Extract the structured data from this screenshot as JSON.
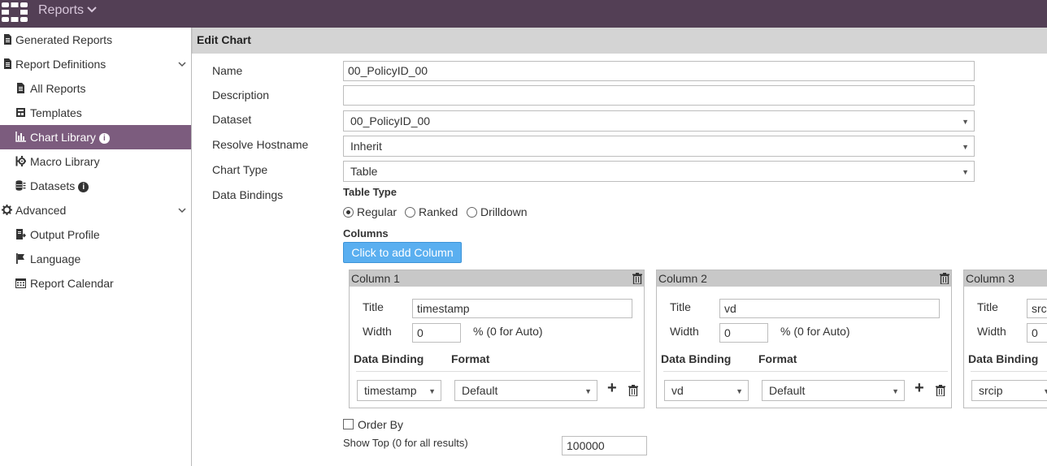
{
  "topbar": {
    "app_name": "Reports"
  },
  "sidebar": {
    "items": [
      {
        "label": "Generated Reports"
      },
      {
        "label": "Report Definitions"
      },
      {
        "label": "All Reports"
      },
      {
        "label": "Templates"
      },
      {
        "label": "Chart Library"
      },
      {
        "label": "Macro Library"
      },
      {
        "label": "Datasets"
      },
      {
        "label": "Advanced"
      },
      {
        "label": "Output Profile"
      },
      {
        "label": "Language"
      },
      {
        "label": "Report Calendar"
      }
    ],
    "active_item": "Chart Library"
  },
  "main": {
    "header": "Edit Chart",
    "fields": {
      "name_label": "Name",
      "name_value": "00_PolicyID_00",
      "description_label": "Description",
      "description_value": "",
      "dataset_label": "Dataset",
      "dataset_value": "00_PolicyID_00",
      "resolve_label": "Resolve Hostname",
      "resolve_value": "Inherit",
      "chart_type_label": "Chart Type",
      "chart_type_value": "Table",
      "data_bindings_label": "Data Bindings"
    },
    "table_type": {
      "label": "Table Type",
      "options": [
        "Regular",
        "Ranked",
        "Drilldown"
      ],
      "selected": "Regular"
    },
    "columns_label": "Columns",
    "add_column_label": "Click to add Column",
    "columns": [
      {
        "header": "Column 1",
        "title_label": "Title",
        "title_value": "timestamp",
        "width_label": "Width",
        "width_value": "0",
        "width_hint": "% (0 for Auto)",
        "binding_label": "Data Binding",
        "format_label": "Format",
        "binding_value": "timestamp",
        "format_value": "Default"
      },
      {
        "header": "Column 2",
        "title_label": "Title",
        "title_value": "vd",
        "width_label": "Width",
        "width_value": "0",
        "width_hint": "% (0 for Auto)",
        "binding_label": "Data Binding",
        "format_label": "Format",
        "binding_value": "vd",
        "format_value": "Default"
      },
      {
        "header": "Column 3",
        "title_label": "Title",
        "title_value": "srci",
        "width_label": "Width",
        "width_value": "0",
        "width_hint": "",
        "binding_label": "Data Binding",
        "format_label": "",
        "binding_value": "srcip",
        "format_value": ""
      }
    ],
    "order_by_label": "Order By",
    "show_top_label": "Show Top (0 for all results)",
    "show_top_value": "100000"
  },
  "colors": {
    "topbar": "#533f55",
    "active_item": "#7c5c7e",
    "primary_button": "#5aaff0",
    "header_bg": "#d4d4d4"
  }
}
